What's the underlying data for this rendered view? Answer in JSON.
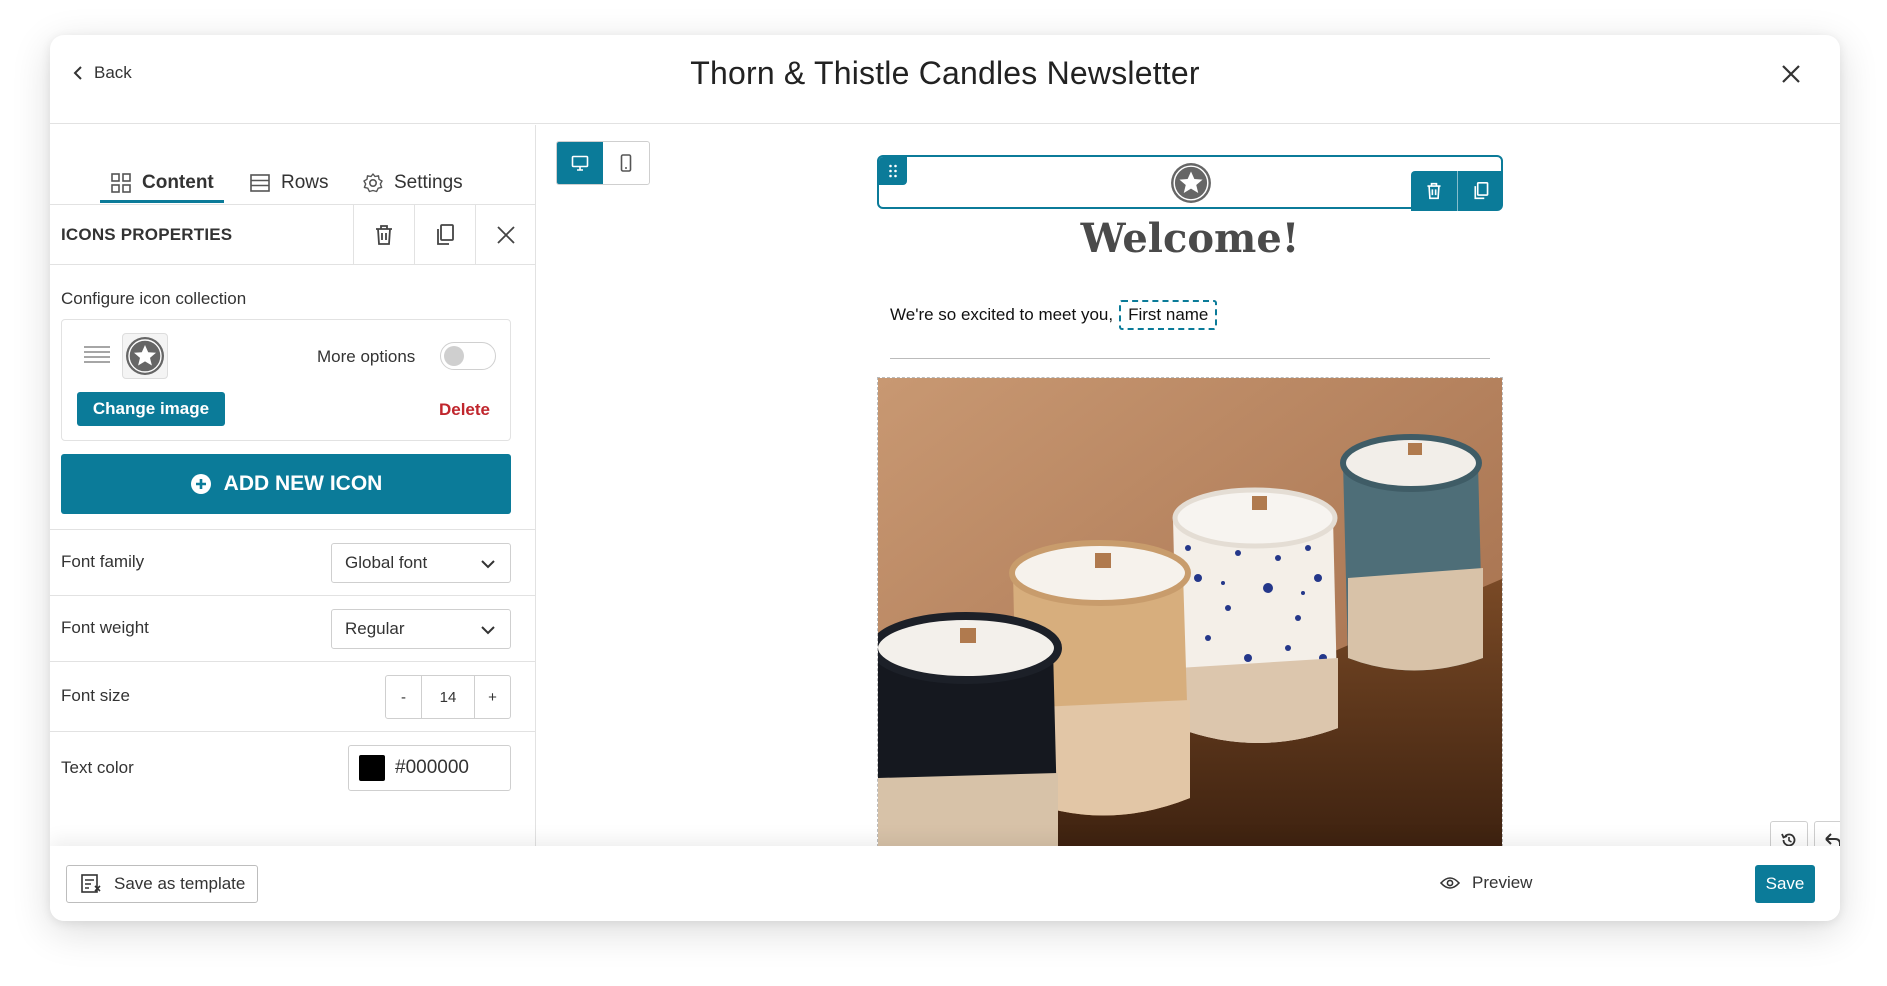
{
  "header": {
    "back_label": "Back",
    "title": "Thorn & Thistle Candles Newsletter"
  },
  "tabs": [
    {
      "label": "Content",
      "icon": "grid-icon",
      "active": true
    },
    {
      "label": "Rows",
      "icon": "rows-icon"
    },
    {
      "label": "Settings",
      "icon": "gear-icon"
    }
  ],
  "properties": {
    "title": "ICONS PROPERTIES",
    "configure_label": "Configure icon collection",
    "more_options_label": "More options",
    "change_image_label": "Change image",
    "delete_label": "Delete",
    "add_icon_label": "ADD NEW ICON",
    "font_family": {
      "label": "Font family",
      "value": "Global font"
    },
    "font_weight": {
      "label": "Font weight",
      "value": "Regular"
    },
    "font_size": {
      "label": "Font size",
      "value": "14",
      "minus": "-",
      "plus": "+"
    },
    "text_color": {
      "label": "Text color",
      "value": "#000000"
    }
  },
  "email": {
    "heading": "Welcome!",
    "greeting": "We're so excited to meet you,",
    "merge_tag": "First name"
  },
  "footer": {
    "save_template_label": "Save as template",
    "preview_label": "Preview",
    "save_label": "Save"
  },
  "colors": {
    "accent": "#0b7b99",
    "danger": "#c0262d"
  }
}
